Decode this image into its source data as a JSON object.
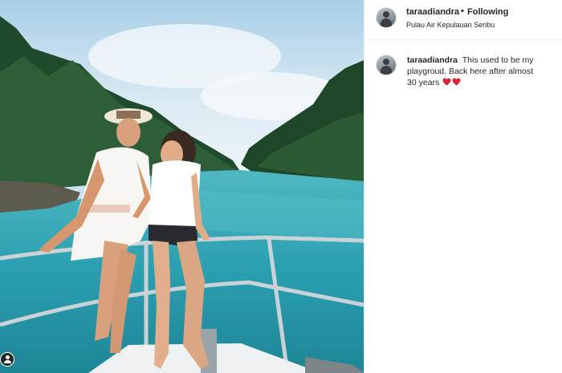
{
  "post": {
    "author": {
      "username": "taraadiandra",
      "separator": "•",
      "follow_state": "Following",
      "location": "Pulau Air Kepulauan Seribu"
    },
    "caption": {
      "username": "taraadiandra",
      "text": "This used to be my playgroud. Back here after almost 30 years",
      "emojis": [
        "red-heart",
        "red-heart"
      ]
    },
    "photo": {
      "description_icon": "user-tag-icon"
    }
  },
  "colors": {
    "text": "#262626",
    "border": "#efefef",
    "heart": "#d7263d",
    "water": "#2a9fb0"
  }
}
